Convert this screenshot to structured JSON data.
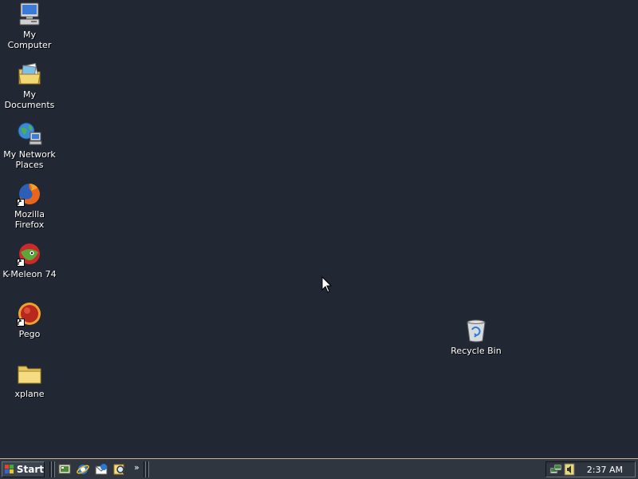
{
  "desktop": {
    "icons": [
      {
        "label": "My Computer",
        "icon": "my-computer-icon"
      },
      {
        "label": "My Documents",
        "icon": "my-documents-icon"
      },
      {
        "label": "My Network Places",
        "icon": "network-places-icon"
      },
      {
        "label": "Mozilla Firefox",
        "icon": "firefox-icon"
      },
      {
        "label": "K-Meleon 74",
        "icon": "k-meleon-icon"
      },
      {
        "label": "Pego",
        "icon": "pego-icon"
      },
      {
        "label": "xplane",
        "icon": "folder-icon"
      },
      {
        "label": "Recycle Bin",
        "icon": "recycle-bin-icon"
      }
    ]
  },
  "taskbar": {
    "start_label": "Start",
    "quick_launch": [
      "show-desktop-icon",
      "internet-explorer-icon",
      "outlook-express-icon",
      "search-icon"
    ],
    "more_label": "»",
    "tray_icons": [
      "network-icon",
      "volume-icon"
    ],
    "clock": "2:37 AM"
  },
  "colors": {
    "desktop_background": "#222833",
    "taskbar_background": "#2f3640",
    "taskbar_border": "#c9b98a",
    "text": "#ffffff"
  }
}
